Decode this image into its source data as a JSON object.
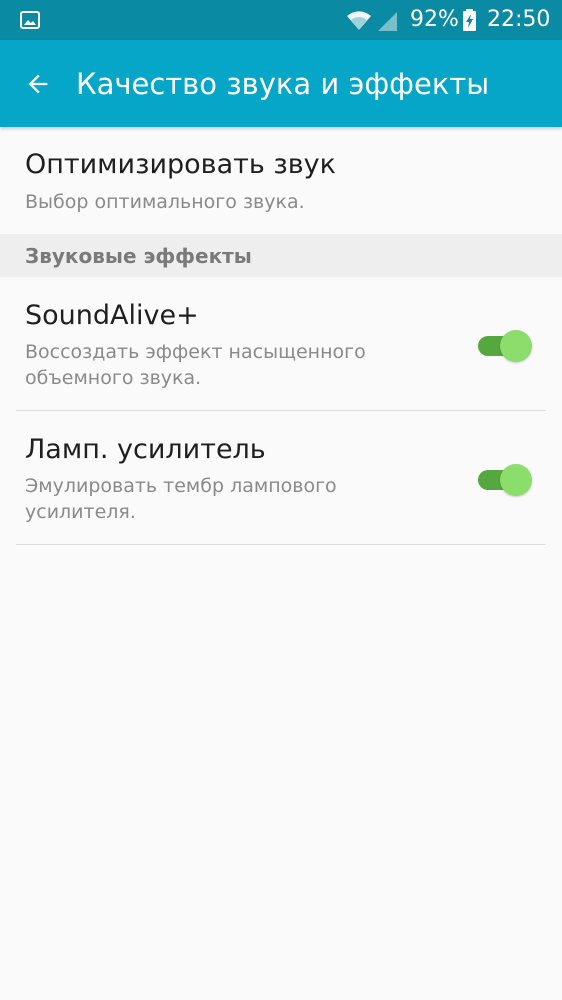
{
  "status_bar": {
    "battery_percent": "92%",
    "time": "22:50",
    "icons": [
      "gallery-icon",
      "wifi-icon",
      "signal-icon",
      "battery-charging-icon"
    ]
  },
  "app_bar": {
    "title": "Качество звука и эффекты",
    "back_icon": "arrow-back-icon",
    "background": "#05a6c8"
  },
  "optimize": {
    "title": "Оптимизировать звук",
    "summary": "Выбор оптимального звука."
  },
  "section": {
    "label": "Звуковые эффекты"
  },
  "settings": [
    {
      "title": "SoundAlive+",
      "summary": "Воссоздать эффект насыщенного объемного звука.",
      "enabled": true
    },
    {
      "title": "Ламп. усилитель",
      "summary": "Эмулировать тембр лампового усилителя.",
      "enabled": true
    }
  ],
  "colors": {
    "status_bar": "#0a8aa3",
    "switch_on_track": "#55a83e",
    "switch_on_thumb": "#8bdd6c"
  }
}
